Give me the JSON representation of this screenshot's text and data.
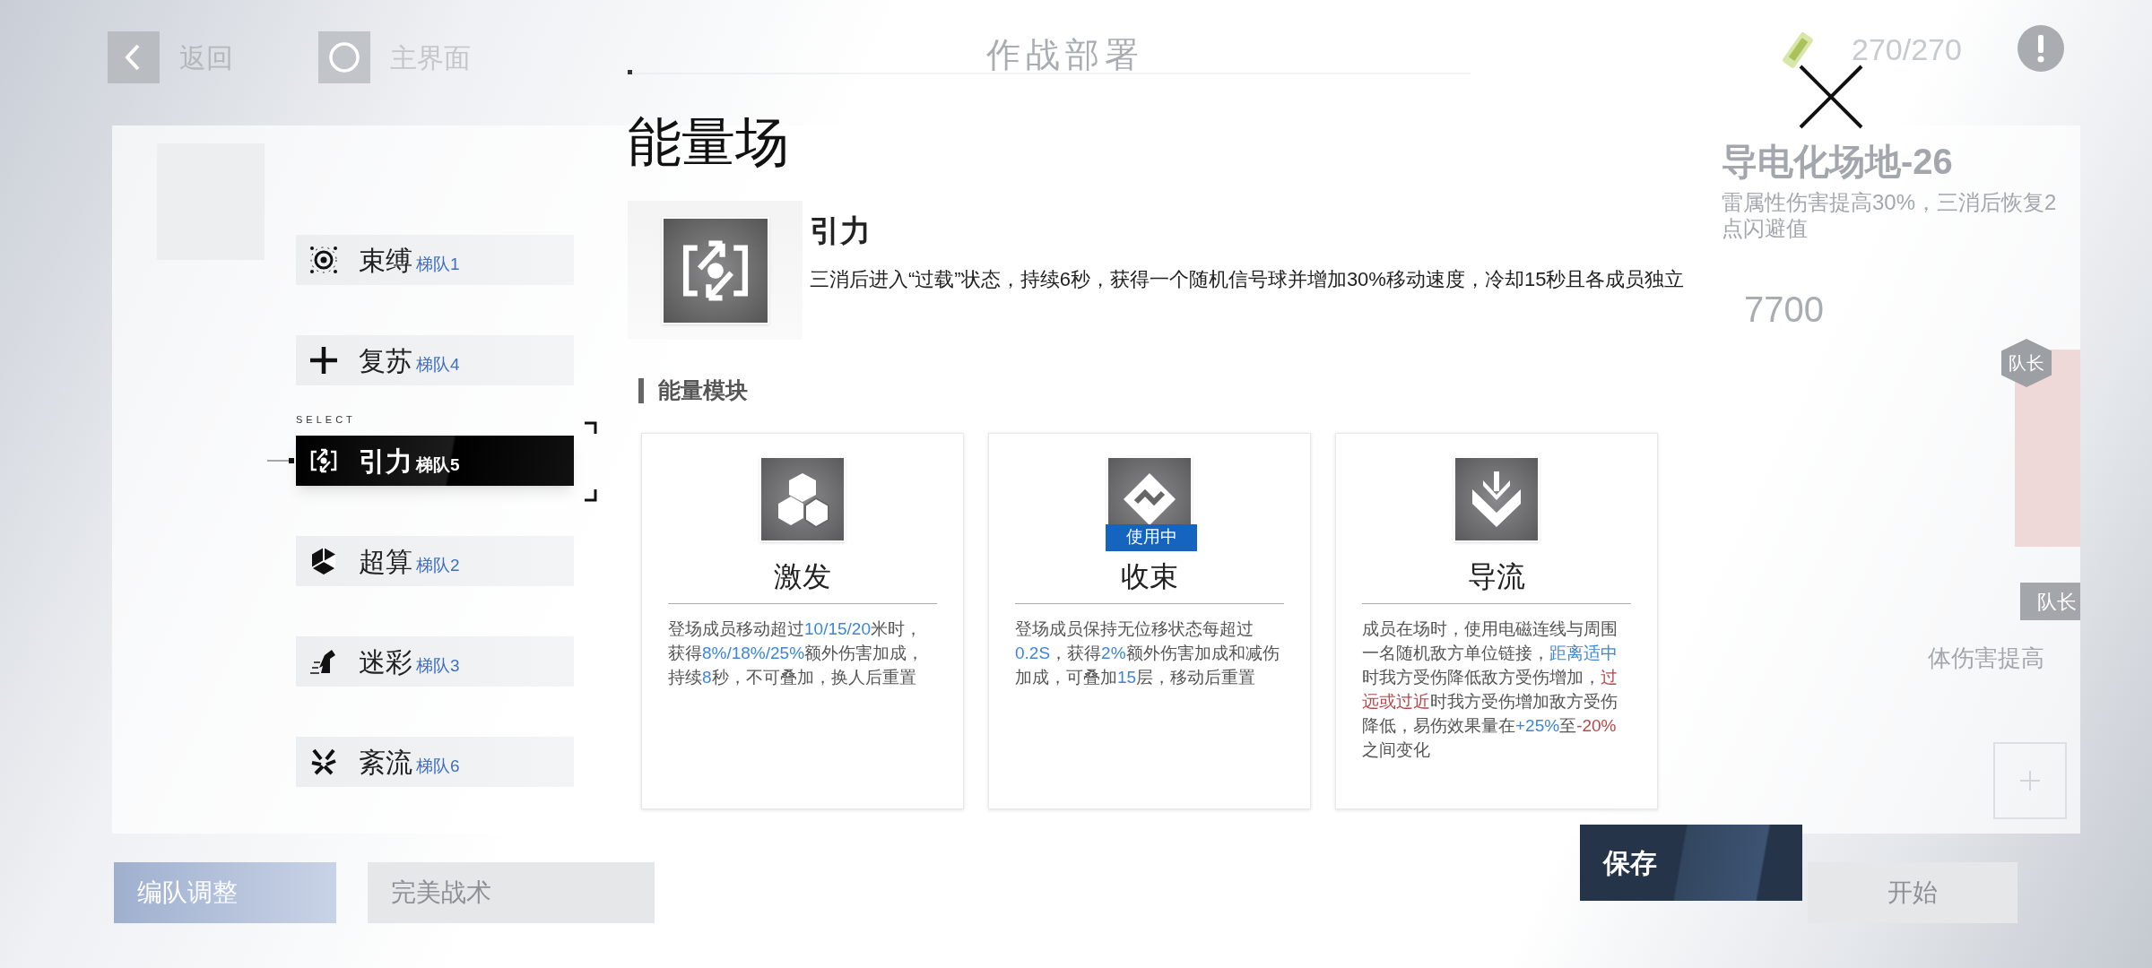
{
  "top_bar": {
    "back_label": "返回",
    "home_label": "主界面",
    "title": "作战部署",
    "stamina": "270/270"
  },
  "background": {
    "stage_title": "导电化场地-26",
    "stage_desc_lines": [
      "雷属性伤害提高30%，三消后恢复2",
      "点闪避值"
    ],
    "score": "7700",
    "leader_badges": [
      "队长",
      "队长"
    ],
    "buff_text": "体伤害提高",
    "buttons": [
      {
        "label": "编队调整",
        "kind": "blue"
      },
      {
        "label": "完美战术",
        "kind": "gray"
      },
      {
        "label": "开始",
        "kind": "gray"
      }
    ]
  },
  "select_label": "SELECT",
  "fields": [
    {
      "name": "束缚",
      "squad": "梯队1",
      "selected": false
    },
    {
      "name": "复苏",
      "squad": "梯队4",
      "selected": false
    },
    {
      "name": "引力",
      "squad": "梯队5",
      "selected": true
    },
    {
      "name": "超算",
      "squad": "梯队2",
      "selected": false
    },
    {
      "name": "迷彩",
      "squad": "梯队3",
      "selected": false
    },
    {
      "name": "紊流",
      "squad": "梯队6",
      "selected": false
    }
  ],
  "panel": {
    "title": "能量场",
    "detail": {
      "name": "引力",
      "description": "三消后进入“过载”状态，持续6秒，获得一个随机信号球并增加30%移动速度，冷却15秒且各成员独立"
    },
    "section_title": "能量模块",
    "in_use_label": "使用中",
    "modules": [
      {
        "name": "激发",
        "in_use": false,
        "description": [
          {
            "text": "登场成员移动超过"
          },
          {
            "text": "10/15/20",
            "color": "#3d86d6"
          },
          {
            "text": "米时，获得"
          },
          {
            "text": "8%/18%/25%",
            "color": "#3d86d6"
          },
          {
            "text": "额外伤害加成，持续"
          },
          {
            "text": "8",
            "color": "#3d86d6"
          },
          {
            "text": "秒，不可叠加，换人后重置"
          }
        ]
      },
      {
        "name": "收束",
        "in_use": true,
        "description": [
          {
            "text": "登场成员保持无位移状态每超过"
          },
          {
            "text": "0.2S",
            "color": "#3d86d6"
          },
          {
            "text": "，获得"
          },
          {
            "text": "2%",
            "color": "#3d86d6"
          },
          {
            "text": "额外伤害加成和减伤加成，可叠加"
          },
          {
            "text": "15",
            "color": "#3d86d6"
          },
          {
            "text": "层，移动后重置"
          }
        ]
      },
      {
        "name": "导流",
        "in_use": false,
        "description": [
          {
            "text": "成员在场时，使用电磁连线与周围一名随机敌方单位链接，"
          },
          {
            "text": "距离适中",
            "color": "#3d86d6"
          },
          {
            "text": "时我方受伤降低敌方受伤增加，"
          },
          {
            "text": "过远或过近",
            "color": "#b5474b"
          },
          {
            "text": "时我方受伤增加敌方受伤降低，易伤效果量在"
          },
          {
            "text": "+25%",
            "color": "#3d86d6"
          },
          {
            "text": "至"
          },
          {
            "text": "-20%",
            "color": "#b5474b"
          },
          {
            "text": "之间变化"
          }
        ]
      }
    ],
    "save_label": "保存"
  }
}
